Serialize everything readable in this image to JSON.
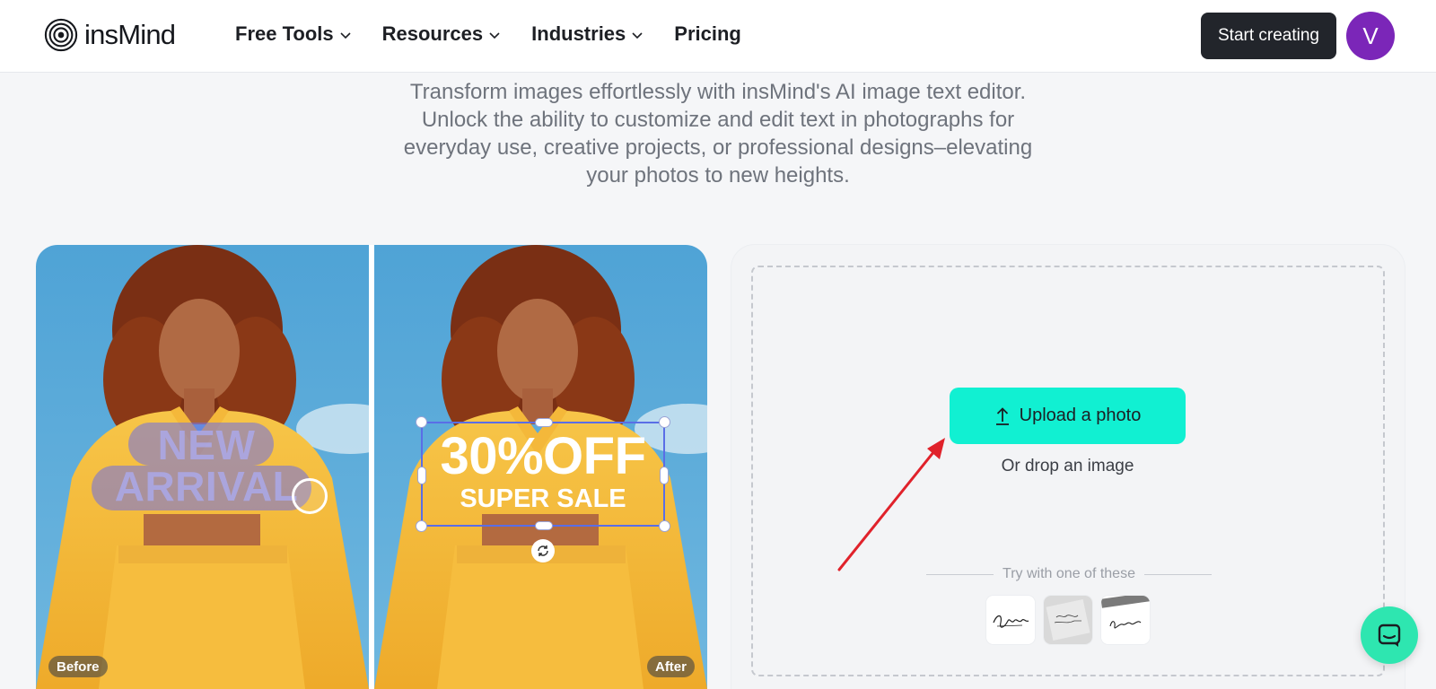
{
  "brand": {
    "name": "insMind"
  },
  "nav": {
    "items": [
      {
        "label": "Free Tools",
        "has_dropdown": true
      },
      {
        "label": "Resources",
        "has_dropdown": true
      },
      {
        "label": "Industries",
        "has_dropdown": true
      },
      {
        "label": "Pricing",
        "has_dropdown": false
      }
    ],
    "cta_label": "Start creating",
    "avatar_initial": "V"
  },
  "intro": {
    "lines": [
      "Transform images effortlessly with insMind's AI image text editor.",
      "Unlock the ability to customize and edit text in photographs for",
      "everyday use, creative projects, or professional designs–elevating",
      "your photos to new heights."
    ]
  },
  "showcase": {
    "before_label": "Before",
    "after_label": "After",
    "before_text_line1": "NEW",
    "before_text_line2": "ARRIVAL",
    "after_text_big": "30%OFF",
    "after_text_small": "SUPER SALE"
  },
  "upload": {
    "button_label": "Upload a photo",
    "drop_text": "Or drop an image",
    "try_text": "Try with one of these",
    "samples": [
      "handwriting-sample-1",
      "handwriting-sample-2",
      "handwriting-sample-3"
    ]
  },
  "colors": {
    "accent": "#11f0d2",
    "cta_dark": "#22252b",
    "avatar": "#7b26b8",
    "chat": "#2ee6b0",
    "annotation_arrow": "#e0222b"
  },
  "icons": [
    "insmind-logo-icon",
    "chevron-down-icon",
    "upload-icon",
    "rotate-icon",
    "chat-icon"
  ]
}
